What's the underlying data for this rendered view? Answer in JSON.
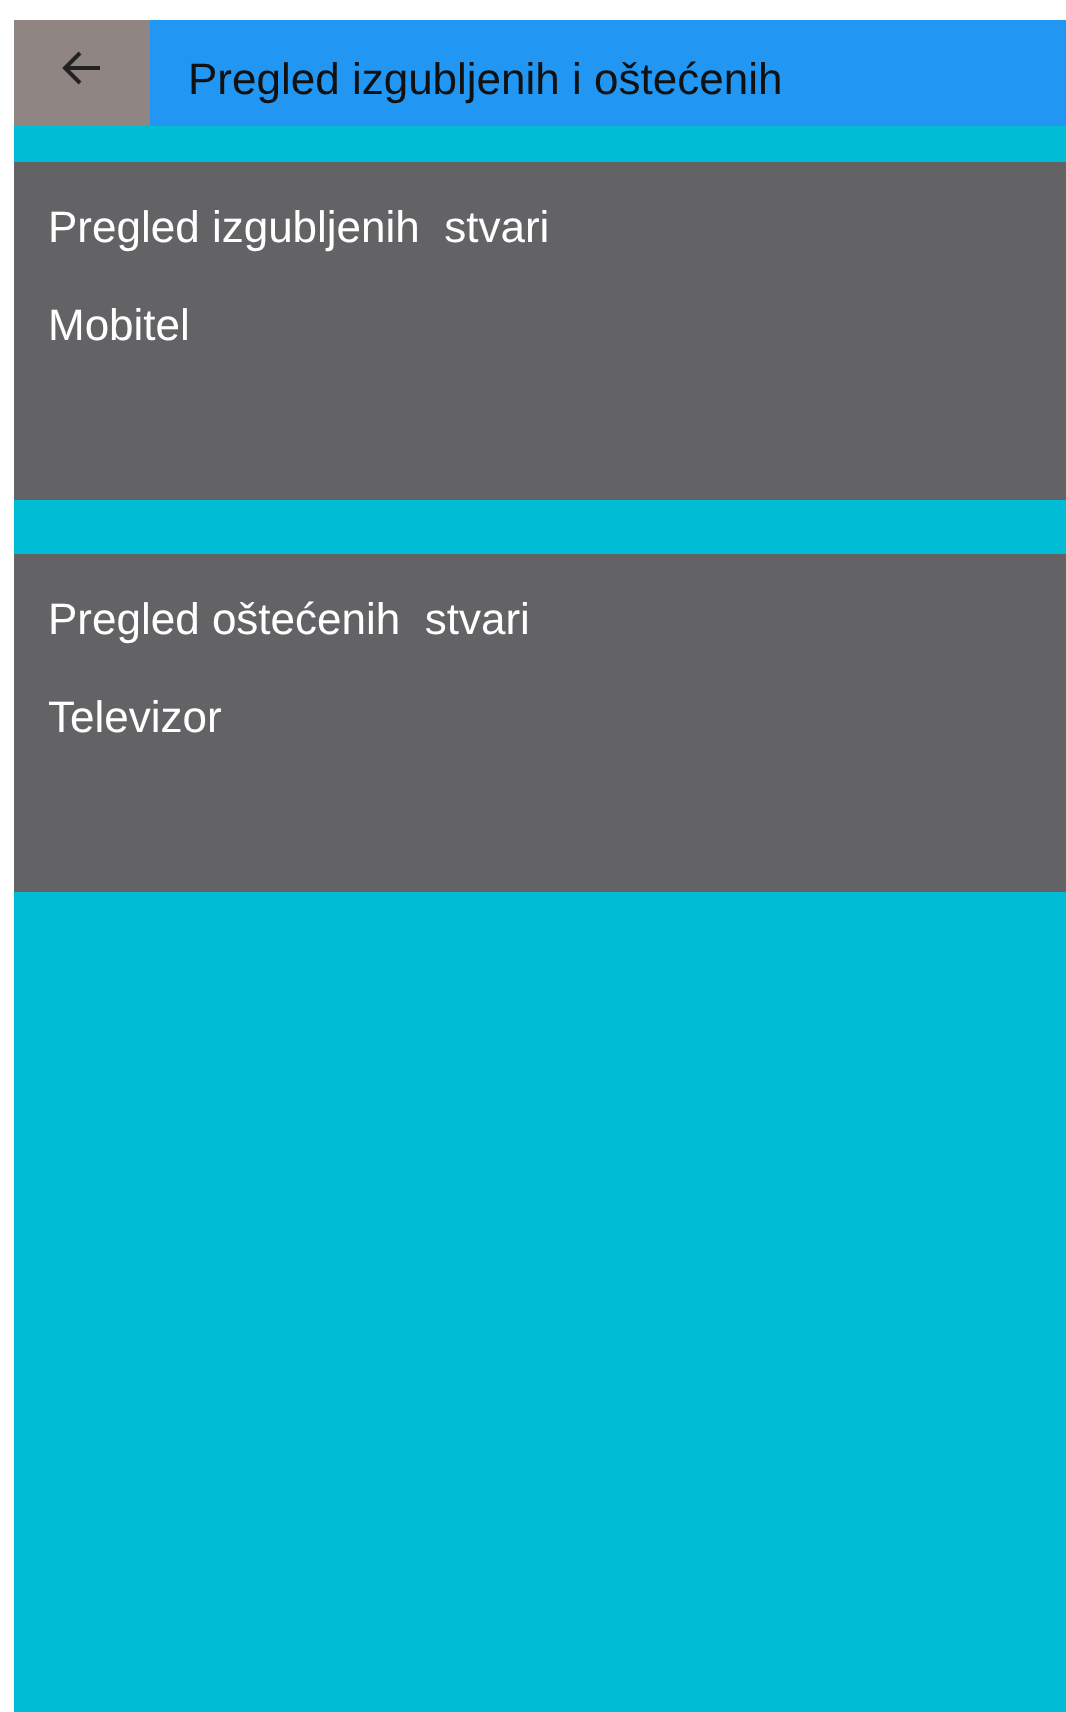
{
  "app_bar": {
    "title": "Pregled izgubljenih i oštećenih"
  },
  "cards": [
    {
      "title": "Pregled izgubljenih  stvari",
      "item": "Mobitel"
    },
    {
      "title": "Pregled oštećenih  stvari",
      "item": "Televizor"
    }
  ]
}
